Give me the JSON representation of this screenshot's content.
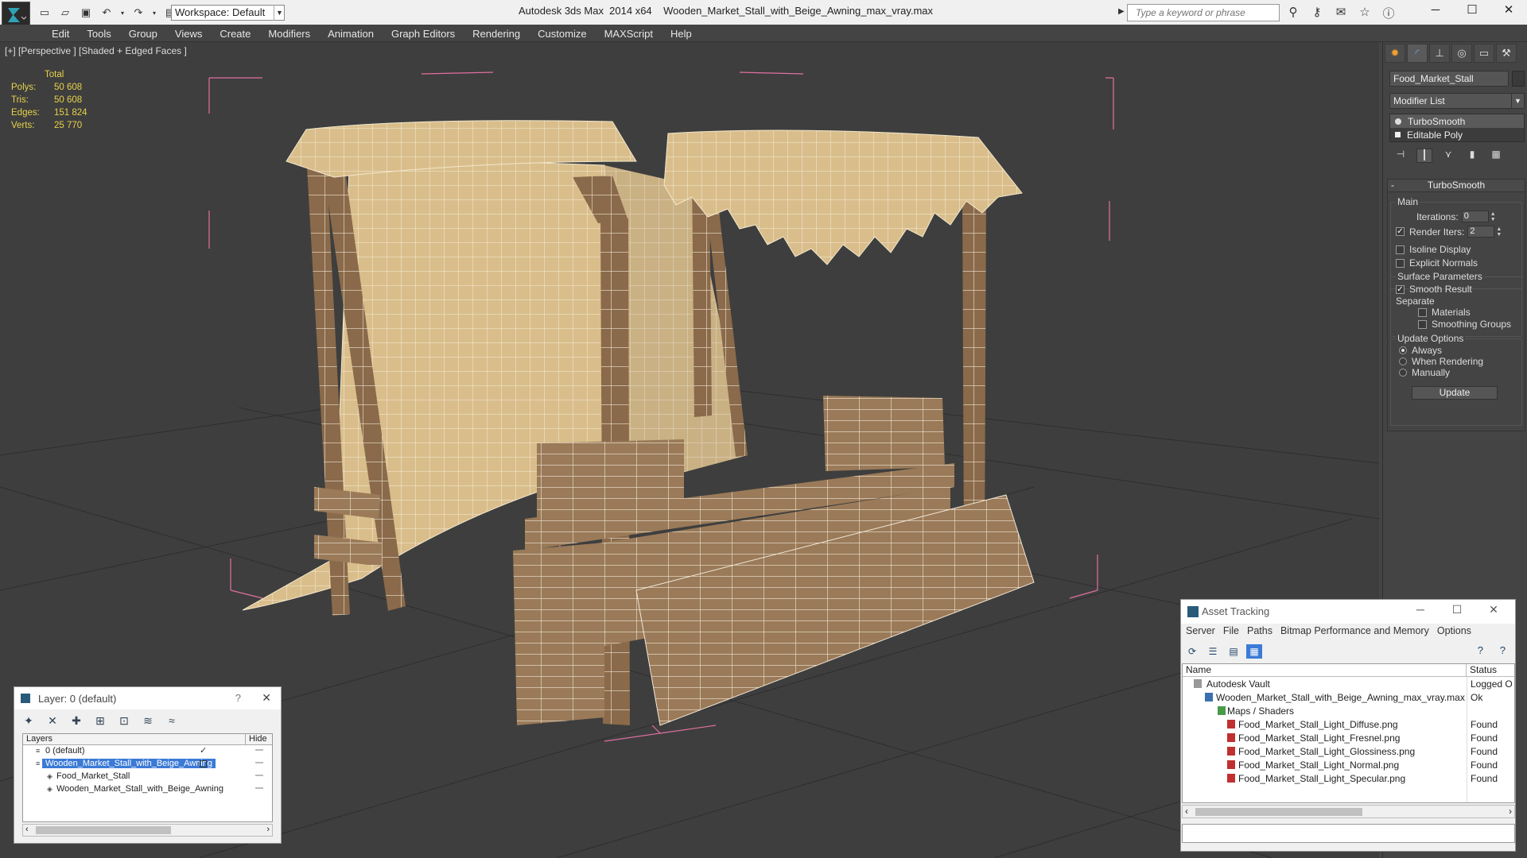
{
  "titlebar": {
    "workspace_label": "Workspace: Default",
    "app_name": "Autodesk 3ds Max  2014 x64",
    "file_name": "Wooden_Market_Stall_with_Beige_Awning_max_vray.max",
    "search_placeholder": "Type a keyword or phrase"
  },
  "menu": {
    "items": [
      "Edit",
      "Tools",
      "Group",
      "Views",
      "Create",
      "Modifiers",
      "Animation",
      "Graph Editors",
      "Rendering",
      "Customize",
      "MAXScript",
      "Help"
    ]
  },
  "viewport": {
    "label": "[+] [Perspective ] [Shaded + Edged Faces ]",
    "stats": {
      "header": "Total",
      "rows": [
        {
          "k": "Polys:",
          "v": "50 608"
        },
        {
          "k": "Tris:",
          "v": "50 608"
        },
        {
          "k": "Edges:",
          "v": "151 824"
        },
        {
          "k": "Verts:",
          "v": "25 770"
        }
      ]
    }
  },
  "command_panel": {
    "object_name": "Food_Market_Stall",
    "modifier_list_label": "Modifier List",
    "stack": [
      "TurboSmooth",
      "Editable Poly"
    ],
    "rollout_title": "TurboSmooth",
    "main_group": "Main",
    "iterations_label": "Iterations:",
    "iterations_value": "0",
    "render_iters_label": "Render Iters:",
    "render_iters_value": "2",
    "isoline_label": "Isoline Display",
    "explicit_normals_label": "Explicit Normals",
    "surface_group": "Surface Parameters",
    "smooth_result_label": "Smooth Result",
    "separate_label": "Separate",
    "materials_label": "Materials",
    "smoothing_groups_label": "Smoothing Groups",
    "update_group": "Update Options",
    "always_label": "Always",
    "when_rendering_label": "When Rendering",
    "manually_label": "Manually",
    "update_button": "Update"
  },
  "layer_window": {
    "title": "Layer: 0 (default)",
    "help": "?",
    "col_layers": "Layers",
    "col_hide": "Hide",
    "rows": [
      {
        "name": "0 (default)"
      },
      {
        "name": "Wooden_Market_Stall_with_Beige_Awning"
      },
      {
        "name": "Food_Market_Stall"
      },
      {
        "name": "Wooden_Market_Stall_with_Beige_Awning"
      }
    ]
  },
  "asset_window": {
    "title": "Asset Tracking",
    "menu": [
      "Server",
      "File",
      "Paths",
      "Bitmap Performance and Memory",
      "Options"
    ],
    "col_name": "Name",
    "col_status": "Status",
    "rows": [
      {
        "name": "Autodesk Vault",
        "status": "Logged O"
      },
      {
        "name": "Wooden_Market_Stall_with_Beige_Awning_max_vray.max",
        "status": "Ok"
      },
      {
        "name": "Maps / Shaders",
        "status": ""
      },
      {
        "name": "Food_Market_Stall_Light_Diffuse.png",
        "status": "Found"
      },
      {
        "name": "Food_Market_Stall_Light_Fresnel.png",
        "status": "Found"
      },
      {
        "name": "Food_Market_Stall_Light_Glossiness.png",
        "status": "Found"
      },
      {
        "name": "Food_Market_Stall_Light_Normal.png",
        "status": "Found"
      },
      {
        "name": "Food_Market_Stall_Light_Specular.png",
        "status": "Found"
      }
    ]
  }
}
